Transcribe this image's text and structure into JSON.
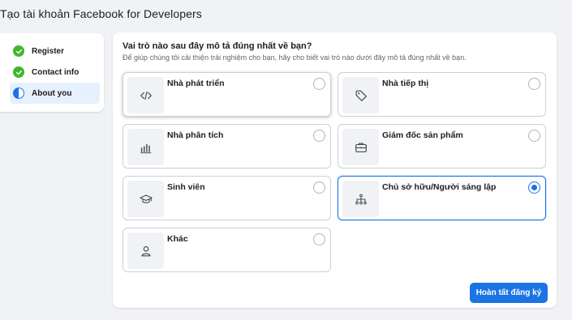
{
  "page": {
    "title": "Tạo tài khoản Facebook for Developers"
  },
  "steps": [
    {
      "label": "Register",
      "status": "done"
    },
    {
      "label": "Contact info",
      "status": "done"
    },
    {
      "label": "About you",
      "status": "active"
    }
  ],
  "question": {
    "title": "Vai trò nào sau đây mô tả đúng nhất về bạn?",
    "subtitle": "Để giúp chúng tôi cải thiện trải nghiệm cho bạn, hãy cho biết vai trò nào dưới đây mô tả đúng nhất về bạn."
  },
  "options": [
    {
      "label": "Nhà phát triển",
      "icon": "code-icon",
      "selected": false
    },
    {
      "label": "Nhà tiếp thị",
      "icon": "tag-icon",
      "selected": false
    },
    {
      "label": "Nhà phân tích",
      "icon": "bar-chart-icon",
      "selected": false
    },
    {
      "label": "Giám đốc sản phẩm",
      "icon": "briefcase-icon",
      "selected": false
    },
    {
      "label": "Sinh viên",
      "icon": "graduation-cap-icon",
      "selected": false
    },
    {
      "label": "Chủ sở hữu/Người sáng lập",
      "icon": "org-chart-icon",
      "selected": true
    },
    {
      "label": "Khác",
      "icon": "person-icon",
      "selected": false
    }
  ],
  "actions": {
    "finish_label": "Hoàn tất đăng ký"
  },
  "colors": {
    "accent": "#1b74e4",
    "success": "#42b72a",
    "background": "#f0f2f5"
  }
}
